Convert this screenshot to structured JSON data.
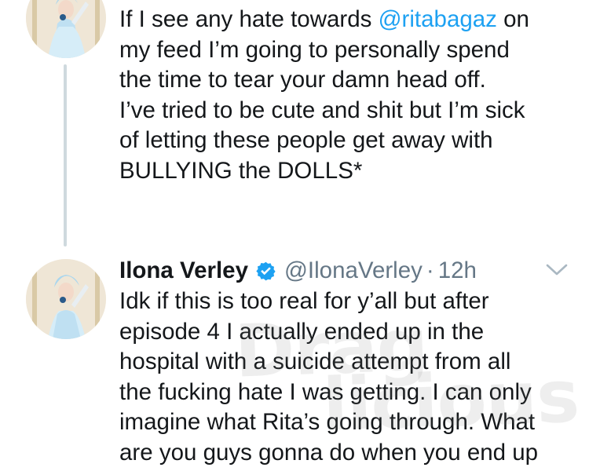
{
  "tweet_1": {
    "lines": [
      {
        "before": "If I see any hate towards ",
        "mention": "@ritabagaz",
        "after": " on"
      },
      {
        "text": "my feed I’m going to personally spend"
      },
      {
        "text": "the time to tear your damn head off."
      },
      {
        "text": "I’ve tried to be cute and shit but I’m sick"
      },
      {
        "text": "of letting these people get away with"
      },
      {
        "text": "BULLYING the DOLLS*"
      }
    ]
  },
  "tweet_2": {
    "name": "Ilona Verley",
    "handle": "@IlonaVerley",
    "separator": "·",
    "time": "12h",
    "lines": [
      "Idk if this is too real for y’all but after",
      "episode 4 I actually ended up in the",
      "hospital with a suicide attempt from all",
      "the fucking hate I was getting. I can only",
      "imagine what Rita’s going through. What",
      "are you guys gonna do when you end up"
    ]
  },
  "watermark": {
    "line1": "Drag",
    "line2": "licious"
  },
  "icons": {
    "verified": "verified-badge-icon",
    "more": "chevron-down-icon"
  },
  "colors": {
    "text": "#14171a",
    "secondary": "#657786",
    "link": "#1da1f2",
    "verified": "#1da1f2",
    "thread_line": "#cfd9de"
  }
}
